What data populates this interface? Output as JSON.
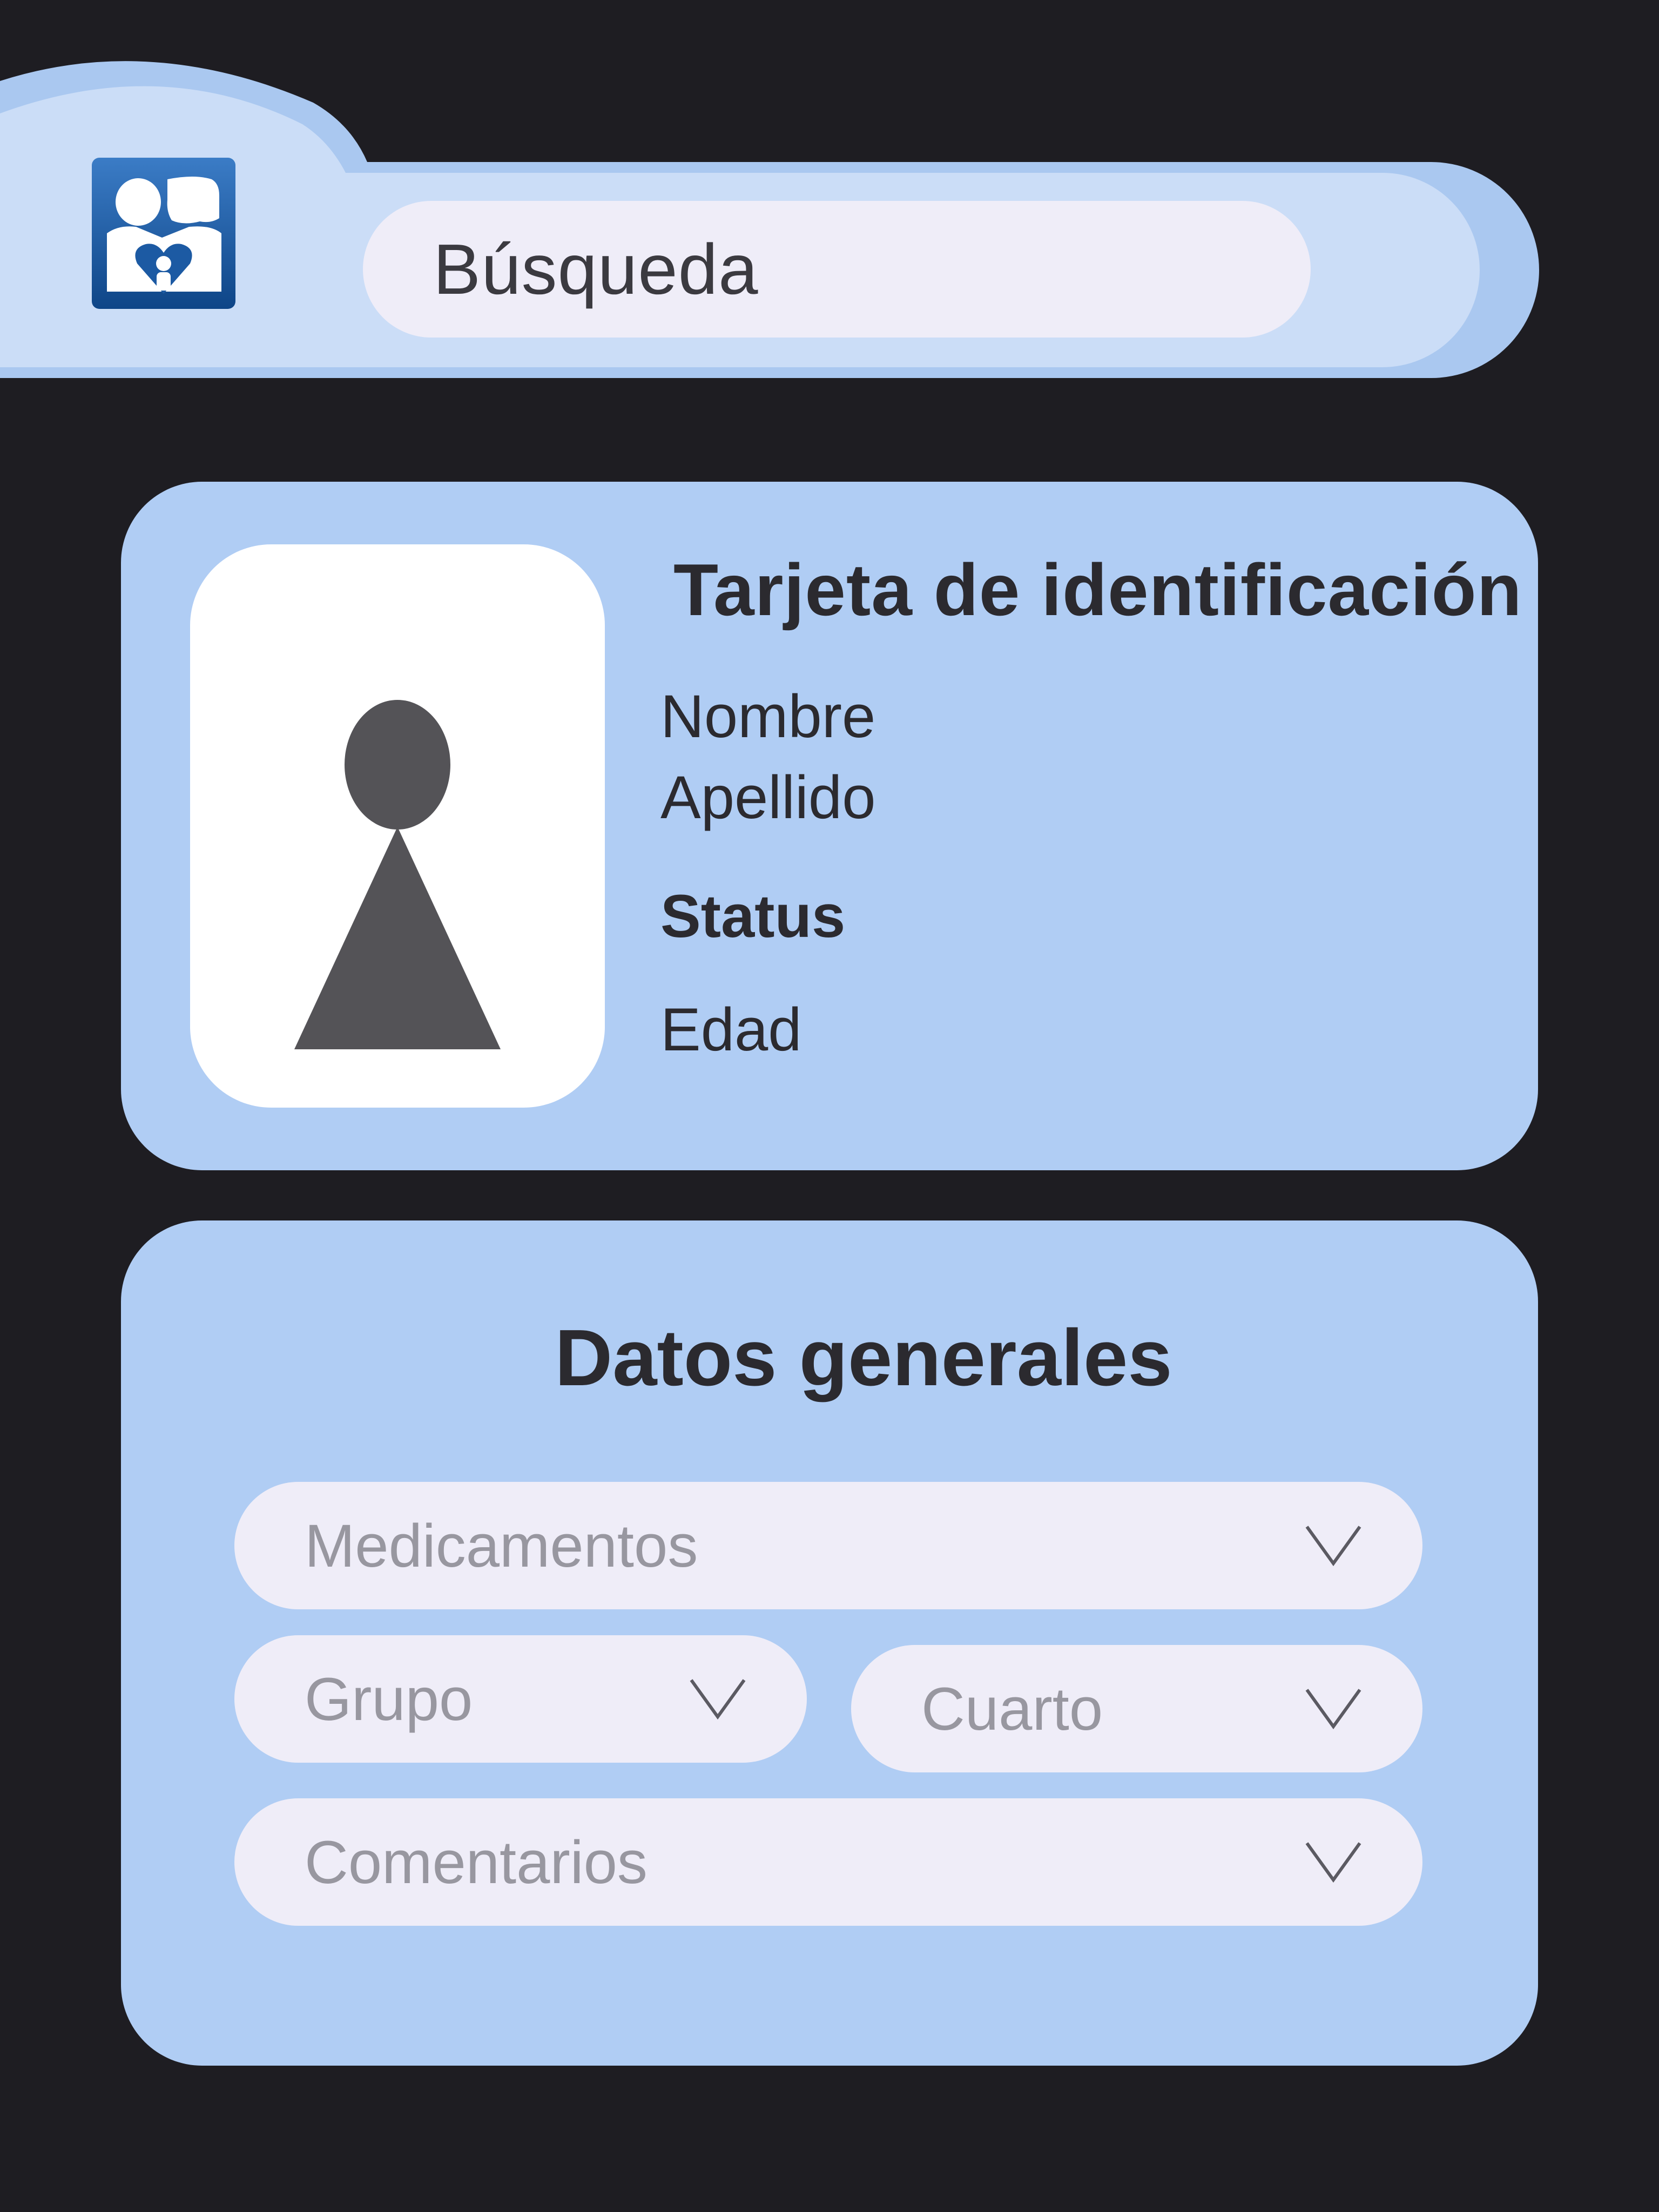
{
  "header": {
    "logo_icon": "family-heart-logo-icon",
    "search": {
      "placeholder": "Búsqueda"
    }
  },
  "id_card": {
    "title": "Tarjeta de identificación",
    "photo_icon": "person-silhouette-icon",
    "first_name_label": "Nombre",
    "last_name_label": "Apellido",
    "status_label": "Status",
    "age_label": "Edad"
  },
  "general_data": {
    "title": "Datos generales",
    "dropdowns": {
      "medications": "Medicamentos",
      "group": "Grupo",
      "room": "Cuarto",
      "comments": "Comentarios"
    },
    "chevron_icon": "chevron-down-icon"
  },
  "colors": {
    "background": "#1e1d22",
    "card": "#b0cdf4",
    "header_light": "#cbddf7",
    "field": "#efedf8",
    "logo_blue": "#1c5aa3",
    "silhouette": "#545357"
  }
}
